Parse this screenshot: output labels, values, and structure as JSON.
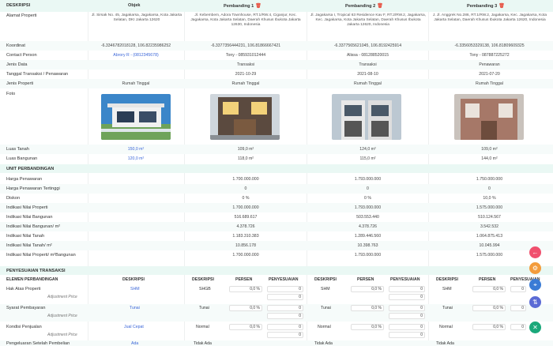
{
  "header": {
    "deskripsi": "DESKRIPSI",
    "objek": "Objek",
    "pembanding1": "Pembanding 1",
    "pembanding2": "Pembanding 2",
    "pembanding3": "Pembanding 3"
  },
  "rows": {
    "alamat_label": "Alamat Properti",
    "alamat_objek": "Jl. Sirsak No. 45, Jagakarsa, Jagakarsa, Kota Jakarta Selatan, DKI Jakarta 12620",
    "alamat_p1": "Jl. Kebembem, Adora Townhouse, RT.1/RW.4, Ciganjur, Kec. Jagakarsa, Kota Jakarta Selatan, Daerah Khusus Ibukota Jakarta 12630, Indonesia",
    "alamat_p2": "Jl. Jagakarsa I, Tropical 63 Residence Kav F, RT.2/RW.2, Jagakarsa, Kec. Jagakarsa, Kota Jakarta Selatan, Daerah Khusus Ibukota Jakarta 12620, Indonesia",
    "alamat_p3": "J. Jl. Anggrek No.286, RT.1/RW.2, Jagakarsa, Kec. Jagakarsa, Kota Jakarta Selatan, Daerah Khusus Ibukota Jakarta 12620, Indonesia",
    "koordinat_label": "Koordinat",
    "koordinat_objek": "-6.3346782018128, 106.82235986252",
    "koordinat_p1": "-6.3377356444231, 106.81866667421",
    "koordinat_p2": "-6.3377565621045, 106.8192425914",
    "koordinat_p3": "-6.3356053329138, 106.81809609325",
    "contact_label": "Contact Person",
    "contact_objek": "Abrory R - (0812345678)",
    "contact_p1": "Tony - 085931012444",
    "contact_p2": "Alissa - 081288520015",
    "contact_p3": "Tony - 087887225272",
    "jenis_data_label": "Jenis Data",
    "jenis_data_p1": "Transaksi",
    "jenis_data_p2": "Transaksi",
    "jenis_data_p3": "Penawaran",
    "tanggal_label": "Tanggal Transaksi / Penawaran",
    "tanggal_p1": "2021-10-29",
    "tanggal_p2": "2021-08-10",
    "tanggal_p3": "2021-07-20",
    "jenis_properti_label": "Jenis Properti",
    "jenis_properti_objek": "Rumah Tinggal",
    "jenis_properti_p1": "Rumah Tinggal",
    "jenis_properti_p2": "Rumah Tinggal",
    "jenis_properti_p3": "Rumah Tinggal",
    "foto_label": "Foto",
    "luas_tanah_label": "Luas Tanah",
    "luas_tanah_objek": "150,0 m²",
    "luas_tanah_p1": "109,0 m²",
    "luas_tanah_p2": "124,0 m²",
    "luas_tanah_p3": "109,0 m²",
    "luas_bangunan_label": "Luas Bangunan",
    "luas_bangunan_objek": "120,0 m²",
    "luas_bangunan_p1": "118,0 m²",
    "luas_bangunan_p2": "115,0 m²",
    "luas_bangunan_p3": "144,0 m²"
  },
  "unit": {
    "section_title": "UNIT PERBANDINGAN",
    "harga_penawaran_label": "Harga Penawaran",
    "harga_penawaran_p1": "1.700.000.000",
    "harga_penawaran_p2": "1.793.000.000",
    "harga_penawaran_p3": "1.750.000.000",
    "harga_terting_label": "Harga Penawaran Tertinggi",
    "harga_terting_p1": "0",
    "harga_terting_p2": "0",
    "harga_terting_p3": "0",
    "diskon_label": "Diskon",
    "diskon_p1": "0 %",
    "diskon_p2": "0 %",
    "diskon_p3": "10,0 %",
    "ind_properti_label": "Indikasi Nilai Properti",
    "ind_properti_p1": "1.700.000.000",
    "ind_properti_p2": "1.793.000.000",
    "ind_properti_p3": "1.575.000.000",
    "ind_bangunan_label": "Indikasi Nilai Bangunan",
    "ind_bangunan_p1": "516.689.617",
    "ind_bangunan_p2": "503.553.440",
    "ind_bangunan_p3": "510.124.567",
    "ind_bangunan_m2_label": "Indikasi Nilai Bangunan/ m²",
    "ind_bangunan_m2_p1": "4.378.726",
    "ind_bangunan_m2_p2": "4.378.726",
    "ind_bangunan_m2_p3": "3.542.532",
    "ind_tanah_label": "Indikasi Nilai Tanah",
    "ind_tanah_p1": "1.183.310.383",
    "ind_tanah_p2": "1.289.446.560",
    "ind_tanah_p3": "1.064.875.413",
    "ind_tanah_m2_label": "Indikasi Nilai Tanah/ m²",
    "ind_tanah_m2_p1": "10.856.178",
    "ind_tanah_m2_p2": "10.398.763",
    "ind_tanah_m2_p3": "10.045.994",
    "ind_properti_m2_label": "Indikasi Nilai Properti/ m²Bangunan",
    "ind_properti_m2_p1": "1.700.000.000",
    "ind_properti_m2_p2": "1.793.000.000",
    "ind_properti_m2_p3": "1.575.000.000"
  },
  "penyesuaian": {
    "section_title": "PENYESUAIAN TRANSAKSI",
    "col_elemen": "ELEMEN PERBANDINGAN",
    "col_deskripsi": "DESKRIPSI",
    "col_persen": "PERSEN",
    "col_penyesuaian": "PENYESUAIAN",
    "hak_label": "Hak Atas Properti",
    "hak_objek": "SHM",
    "hak_p1": "SHGB",
    "hak_p2": "SHM",
    "hak_p3": "SHM",
    "adj_label": "Adjustment Price",
    "syarat_label": "Syarat Pembayaran",
    "syarat_objek": "Tunai",
    "syarat_p1": "Tunai",
    "syarat_p2": "Tunai",
    "syarat_p3": "Tunai",
    "kondisi_label": "Kondisi Penjualan",
    "kondisi_objek": "Jual Cepat",
    "kondisi_p1": "Normal",
    "kondisi_p2": "Normal",
    "kondisi_p3": "Normal",
    "pengeluaran_label": "Pengeluaran Setelah Pembelian",
    "pengeluaran_objek": "Ada",
    "pengeluaran_p1": "Tidak Ada",
    "pengeluaran_p2": "Tidak Ada",
    "pengeluaran_p3": "Tidak Ada",
    "persen_value": "0,0 %",
    "zero": "0"
  },
  "fabs": {
    "back_color": "#f0506e",
    "settings_color": "#f39c3c",
    "location_color": "#3a7bd5",
    "swap_color": "#5b6bd5",
    "close_color": "#1aa87a"
  }
}
